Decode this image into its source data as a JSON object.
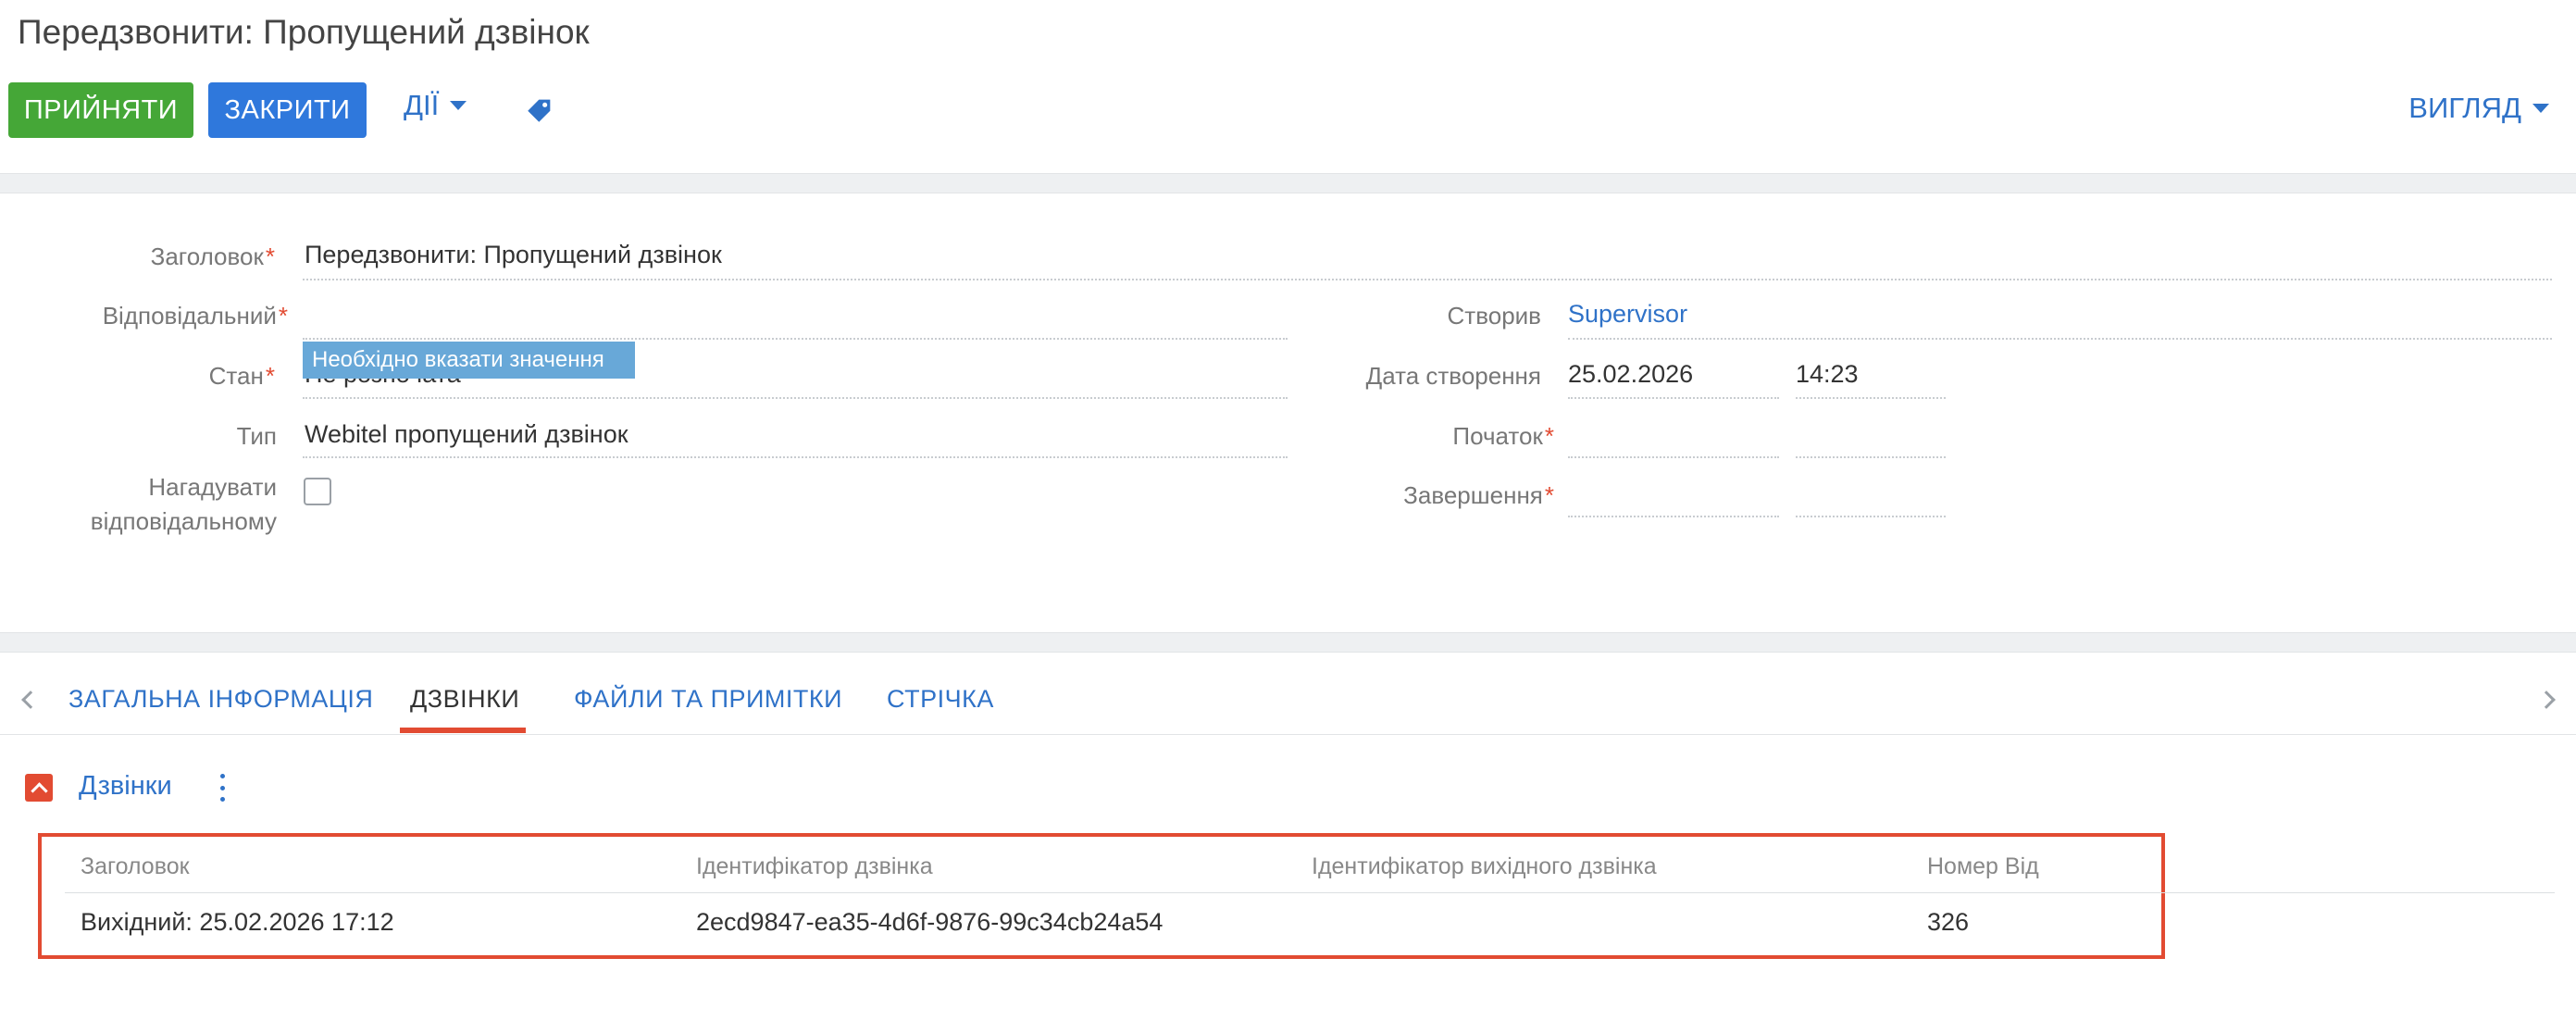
{
  "header": {
    "title": "Передзвонити: Пропущений дзвінок",
    "accept_label": "ПРИЙНЯТИ",
    "close_label": "ЗАКРИТИ",
    "actions_label": "ДІЇ",
    "view_label": "ВИГЛЯД"
  },
  "form": {
    "title_label": "Заголовок",
    "title_value": "Передзвонити: Пропущений дзвінок",
    "owner_label": "Відповідальний",
    "owner_value": "",
    "status_label": "Стан",
    "status_value": "Не розпочата",
    "validation_tooltip": "Необхідно вказати значення",
    "type_label": "Тип",
    "type_value": "Webitel пропущений дзвінок",
    "remind_label_line1": "Нагадувати",
    "remind_label_line2": "відповідальному",
    "remind_checked": false,
    "created_by_label": "Створив",
    "created_by_value": "Supervisor",
    "created_on_label": "Дата створення",
    "created_on_date": "25.02.2026",
    "created_on_time": "14:23",
    "start_label": "Початок",
    "start_date": "",
    "start_time": "",
    "end_label": "Завершення",
    "end_date": "",
    "end_time": ""
  },
  "tabs": [
    {
      "label": "ЗАГАЛЬНА ІНФОРМАЦІЯ",
      "active": false
    },
    {
      "label": "ДЗВІНКИ",
      "active": true
    },
    {
      "label": "ФАЙЛИ ТА ПРИМІТКИ",
      "active": false
    },
    {
      "label": "СТРІЧКА",
      "active": false
    }
  ],
  "calls": {
    "title": "Дзвінки",
    "columns": [
      "Заголовок",
      "Ідентифікатор дзвінка",
      "Ідентифікатор вихідного дзвінка",
      "Номер Від"
    ],
    "rows": [
      [
        "Вихідний: 25.02.2026 17:12",
        "2ecd9847-ea35-4d6f-9876-99c34cb24a54",
        "",
        "326"
      ]
    ]
  },
  "colors": {
    "accent": "#2f72c8",
    "accept": "#45a737",
    "primary": "#2f78dc",
    "highlight": "#e24b32"
  }
}
